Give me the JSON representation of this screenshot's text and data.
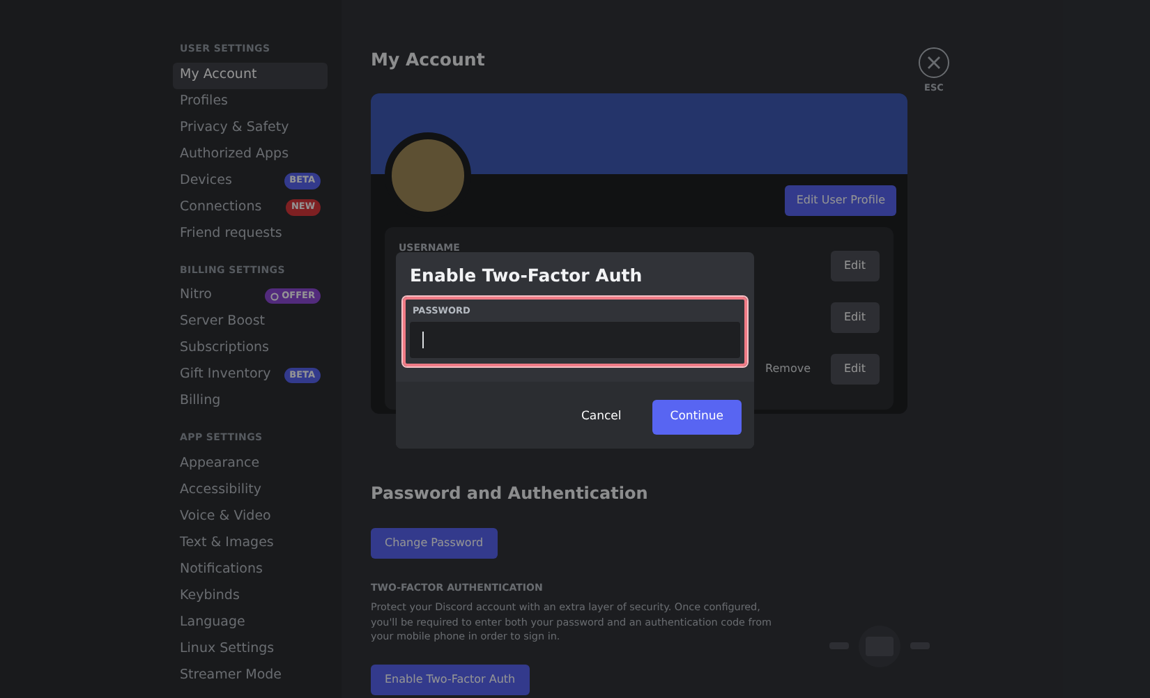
{
  "sidebar": {
    "sections": [
      {
        "title": "USER SETTINGS",
        "items": [
          {
            "label": "My Account",
            "selected": true
          },
          {
            "label": "Profiles",
            "selected": false
          },
          {
            "label": "Privacy & Safety",
            "selected": false
          },
          {
            "label": "Authorized Apps",
            "selected": false
          },
          {
            "label": "Devices",
            "selected": false,
            "badge": {
              "text": "BETA",
              "kind": "beta"
            }
          },
          {
            "label": "Connections",
            "selected": false,
            "badge": {
              "text": "NEW",
              "kind": "new"
            }
          },
          {
            "label": "Friend requests",
            "selected": false
          }
        ]
      },
      {
        "title": "BILLING SETTINGS",
        "items": [
          {
            "label": "Nitro",
            "selected": false,
            "badge": {
              "text": "OFFER",
              "kind": "offer"
            }
          },
          {
            "label": "Server Boost",
            "selected": false
          },
          {
            "label": "Subscriptions",
            "selected": false
          },
          {
            "label": "Gift Inventory",
            "selected": false,
            "badge": {
              "text": "BETA",
              "kind": "beta"
            }
          },
          {
            "label": "Billing",
            "selected": false
          }
        ]
      },
      {
        "title": "APP SETTINGS",
        "items": [
          {
            "label": "Appearance",
            "selected": false
          },
          {
            "label": "Accessibility",
            "selected": false
          },
          {
            "label": "Voice & Video",
            "selected": false
          },
          {
            "label": "Text & Images",
            "selected": false
          },
          {
            "label": "Notifications",
            "selected": false
          },
          {
            "label": "Keybinds",
            "selected": false
          },
          {
            "label": "Language",
            "selected": false
          },
          {
            "label": "Linux Settings",
            "selected": false
          },
          {
            "label": "Streamer Mode",
            "selected": false
          }
        ]
      }
    ]
  },
  "main": {
    "title": "My Account",
    "edit_profile_button": "Edit User Profile",
    "fields": [
      {
        "label": "USERNAME",
        "action": "Edit"
      },
      {
        "action": "Edit"
      },
      {
        "secondary_action": "Remove",
        "action": "Edit"
      }
    ],
    "password_section": {
      "title": "Password and Authentication",
      "change_button": "Change Password",
      "two_factor_heading": "TWO-FACTOR AUTHENTICATION",
      "description": "Protect your Discord account with an extra layer of security. Once configured, you'll be required to enter both your password and an authentication code from your mobile phone in order to sign in.",
      "enable_button": "Enable Two-Factor Auth"
    }
  },
  "close_button": {
    "caption": "ESC"
  },
  "dialog": {
    "title": "Enable Two-Factor Auth",
    "field": {
      "label": "PASSWORD",
      "highlighted": true
    },
    "buttons": [
      {
        "label": "Cancel",
        "kind": "link"
      },
      {
        "label": "Continue",
        "kind": "primary"
      }
    ]
  }
}
